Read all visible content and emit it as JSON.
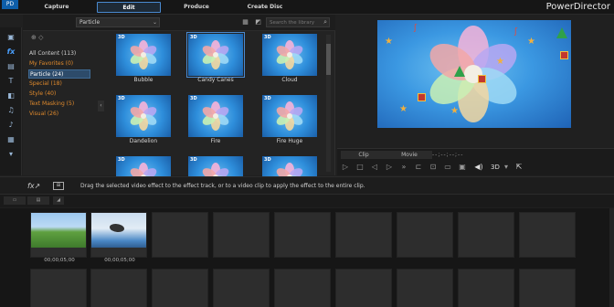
{
  "app": {
    "title": "PowerDirector",
    "logo": "PD"
  },
  "nav": {
    "tabs": [
      {
        "label": "Capture"
      },
      {
        "label": "Edit"
      },
      {
        "label": "Produce"
      },
      {
        "label": "Create Disc"
      }
    ],
    "active": "Edit"
  },
  "library": {
    "dropdown_value": "Particle",
    "search_placeholder": "Search the library",
    "categories": [
      {
        "label": "All Content (113)"
      },
      {
        "label": "My Favorites  (0)"
      },
      {
        "label": "Particle  (24)"
      },
      {
        "label": "Special  (18)"
      },
      {
        "label": "Style  (40)"
      },
      {
        "label": "Text Masking  (5)"
      },
      {
        "label": "Visual  (26)"
      }
    ],
    "selected_category": "Particle  (24)",
    "effects": [
      {
        "label": "Bubble",
        "badge": "3D"
      },
      {
        "label": "Candy Canes",
        "badge": "3D"
      },
      {
        "label": "Cloud",
        "badge": "3D"
      },
      {
        "label": "Dandelion",
        "badge": "3D"
      },
      {
        "label": "Fire",
        "badge": "3D"
      },
      {
        "label": "Fire Huge",
        "badge": "3D"
      },
      {
        "label": "",
        "badge": "3D"
      },
      {
        "label": "",
        "badge": "3D"
      },
      {
        "label": "",
        "badge": "3D"
      }
    ],
    "selected_effect": "Candy Canes"
  },
  "preview": {
    "clip_label": "Clip",
    "movie_label": "Movie",
    "timecode": "--;--;--;--",
    "mode_3d": "3D"
  },
  "hint": {
    "text": "Drag the selected video effect to the effect track, or to a video clip to apply the effect to the entire clip."
  },
  "storyboard": {
    "clips": [
      {
        "timecode": "00;00;05;00"
      },
      {
        "timecode": "00;00;05;00"
      }
    ]
  },
  "colors": {
    "accent": "#4a8ad0",
    "category_text": "#e08a2c",
    "background": "#202020"
  }
}
